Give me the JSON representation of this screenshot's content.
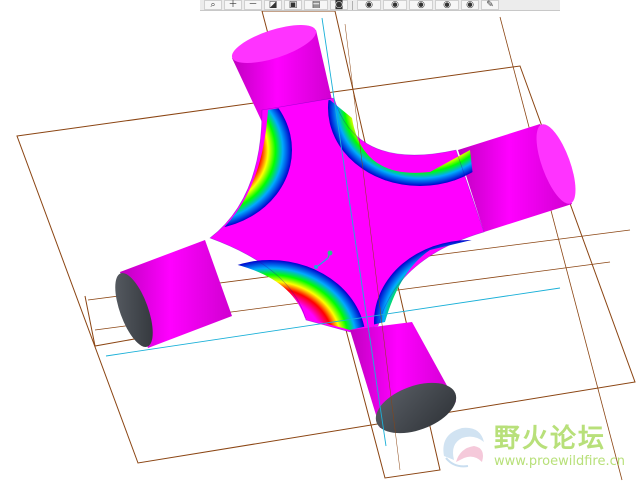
{
  "toolbar": {
    "buttons": [
      {
        "name": "zoom-window-icon",
        "glyph": "⌕"
      },
      {
        "name": "zoom-in-icon",
        "glyph": "＋"
      },
      {
        "name": "zoom-out-icon",
        "glyph": "－"
      },
      {
        "name": "refit-icon",
        "glyph": "◪"
      },
      {
        "name": "repaint-icon",
        "glyph": "▣"
      },
      {
        "name": "saved-view-icon",
        "glyph": "▤"
      },
      {
        "name": "camera-icon",
        "glyph": "◙"
      },
      {
        "name": "datum-planes-icon",
        "glyph": "◉"
      },
      {
        "name": "datum-axes-icon",
        "glyph": "◉"
      },
      {
        "name": "datum-points-icon",
        "glyph": "◉"
      },
      {
        "name": "coordinate-systems-icon",
        "glyph": "◉"
      },
      {
        "name": "visibility-icon",
        "glyph": "◉"
      },
      {
        "name": "annotation-icon",
        "glyph": "✎"
      }
    ]
  },
  "watermark": {
    "title": "野火论坛",
    "url": "www.proewildfire.cn"
  },
  "colors": {
    "magenta": "#ff00ff",
    "datum_lines": "#8b4513",
    "axis_lines": "#1ab0d8",
    "watermark": "#b8e07a"
  }
}
